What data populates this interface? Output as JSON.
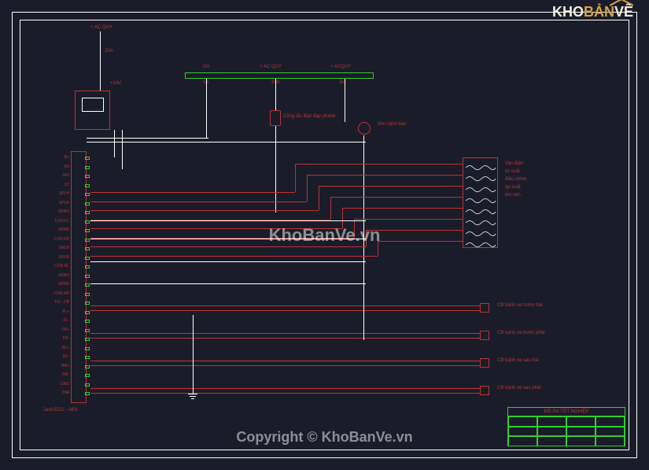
{
  "logo": {
    "part1": "KHO",
    "part2": "BẢN",
    "part3": "VẼ"
  },
  "top_labels": {
    "ac_quy": "+ AC QUY",
    "amp20": "20A",
    "v24": "+24V",
    "igi": "IGI",
    "ac_quy2": "+ AC QUY",
    "acquy3": "+ ACQUY",
    "fuse1": "5A",
    "fuse2": "20A",
    "fuse3": "5A",
    "switch_label": "Công tắc\nBàn đạp phanh",
    "warning": "đèn\ncảnh báo"
  },
  "ecu_pins": [
    "B+",
    "SR",
    "24V",
    "ST",
    "SPLH",
    "SPLR",
    "SPRH",
    "CON FL",
    "SPRR",
    "CON FR",
    "SRLH",
    "SRLR",
    "CON RL",
    "SRRH",
    "SRRR",
    "CON RR",
    "FO - CB",
    "FL+",
    "FL-",
    "FR+",
    "FR-",
    "RL+",
    "RL-",
    "RR+",
    "RR-",
    "GND",
    "2SA"
  ],
  "ecu_label": "Jack ECU - ABS",
  "coil_labels": [
    "Van điện",
    "từ xuất",
    "điều chỉnh",
    "áp xuất",
    "khí nén",
    "",
    "",
    ""
  ],
  "sensor_labels": [
    "CB bánh xe\ntrước trái",
    "CB bánh xe\ntrước phải",
    "CB bánh xe\nsau trái",
    "CB bánh xe\nsau phải"
  ],
  "title_block": {
    "title": "ĐỒ ÁN TỐT NGHIỆP",
    "cells": [
      "",
      "",
      "",
      "",
      "",
      "",
      "",
      "",
      "",
      "",
      "",
      ""
    ]
  },
  "watermark": "KhoBanVe.vn",
  "copyright": "Copyright © KhoBanVe.vn"
}
